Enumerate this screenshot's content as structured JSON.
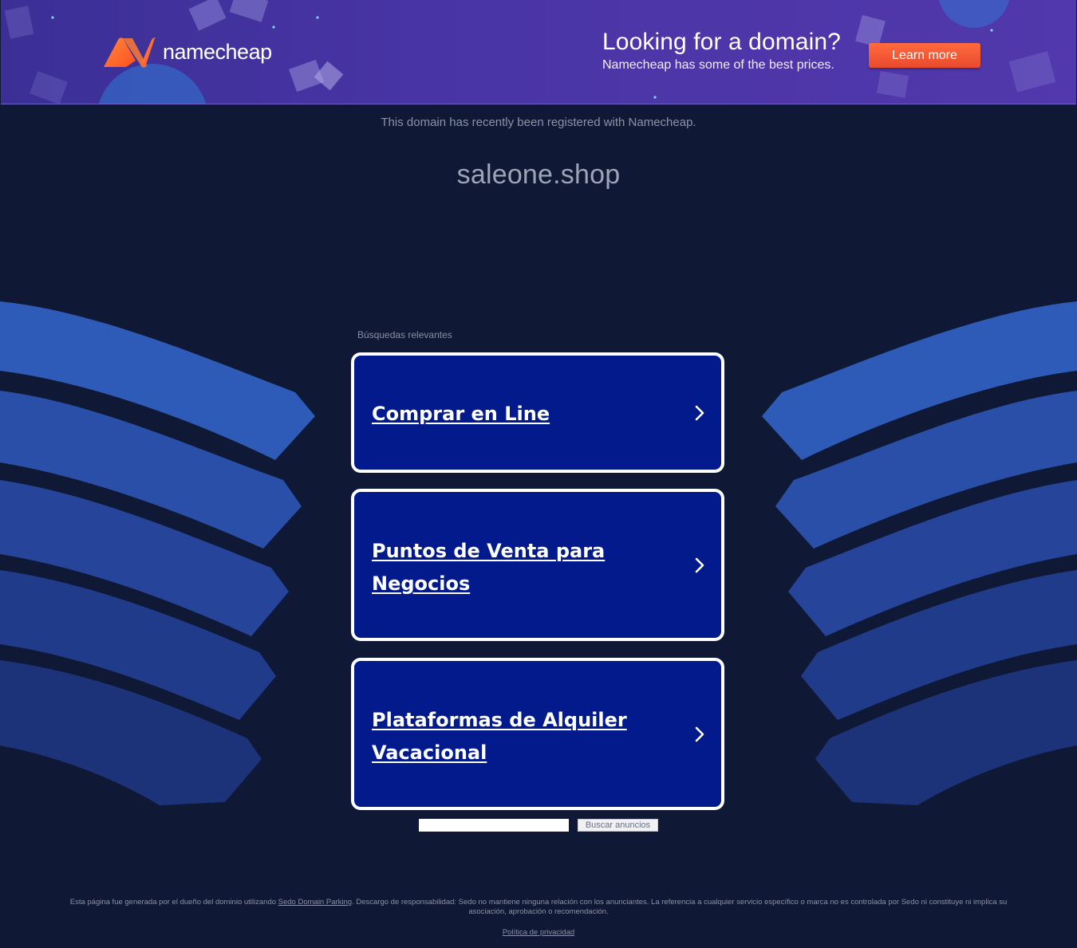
{
  "banner": {
    "logo_text": "namecheap",
    "promo_title": "Looking for a domain?",
    "promo_subtitle": "Namecheap has some of the best prices.",
    "learn_more_label": "Learn more",
    "colors": {
      "background": "#4a35a6",
      "button": "#ef5433",
      "logo_orange": "#ff6b2b"
    }
  },
  "header": {
    "registered_note": "This domain has recently been registered with Namecheap.",
    "domain": "saleone.shop"
  },
  "ads": {
    "label": "Búsquedas relevantes",
    "items": [
      {
        "label": "Comprar en Line",
        "icon": "chevron-right-icon"
      },
      {
        "label": "Puntos de Venta para Negocios",
        "icon": "chevron-right-icon"
      },
      {
        "label": "Plataformas de Alquiler Vacacional",
        "icon": "chevron-right-icon"
      }
    ],
    "colors": {
      "card_background": "#031a8d",
      "card_border": "#ffffff"
    }
  },
  "search": {
    "input_value": "",
    "button_label": "Buscar anuncios"
  },
  "footer": {
    "text_before_link": "Esta página fue generada por el dueño del dominio utilizando ",
    "link_label": "Sedo Domain Parking",
    "text_after_link": ". Descargo de responsabilidad: Sedo no mantiene ninguna relación con los anunciantes. La referencia a cualquier servicio específico o marca no es controlada por Sedo ni constituye ni implica su asociación, aprobación o recomendación.",
    "privacy_label": "Política de privacidad"
  },
  "page": {
    "background": "#0f1834"
  }
}
